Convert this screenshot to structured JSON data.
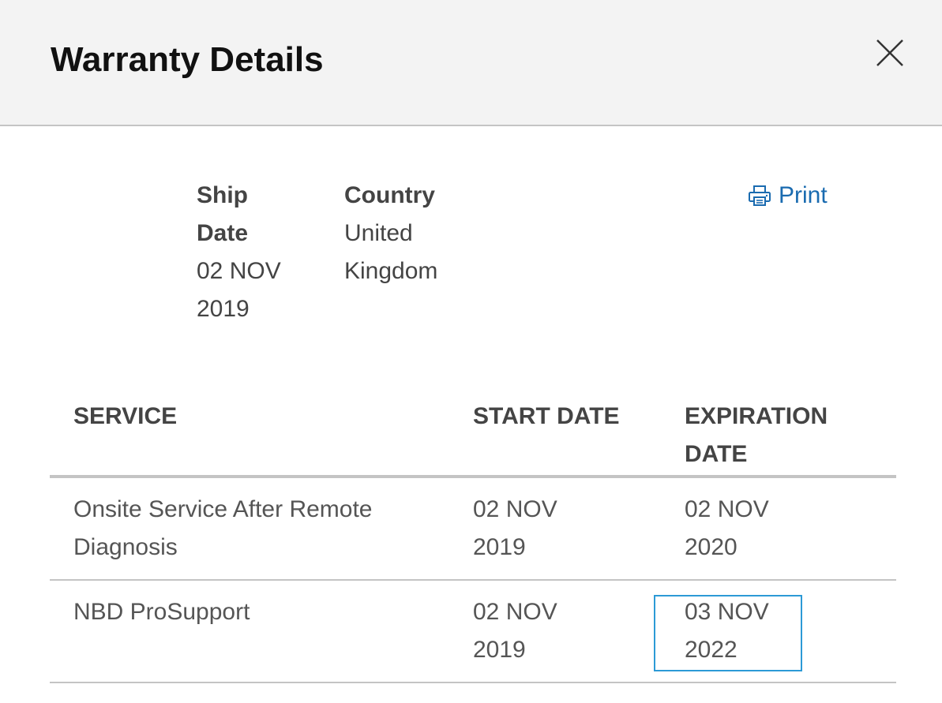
{
  "modal": {
    "title": "Warranty Details",
    "close_icon": "close-icon"
  },
  "ship_date": {
    "label": "Ship Date",
    "value": "02 NOV 2019"
  },
  "country": {
    "label": "Country",
    "value": "United Kingdom"
  },
  "print": {
    "label": "Print",
    "icon": "printer-icon",
    "color": "#1a6bb0"
  },
  "table": {
    "headers": [
      "SERVICE",
      "START DATE",
      "EXPIRATION DATE"
    ],
    "rows": [
      {
        "service": "Onsite Service After Remote Diagnosis",
        "start": "02 NOV 2019",
        "expiration": "02 NOV 2020"
      },
      {
        "service": "NBD ProSupport",
        "start": "02 NOV 2019",
        "expiration": "03 NOV 2022",
        "highlighted": true
      }
    ],
    "highlight_color": "#2c9ad6"
  }
}
